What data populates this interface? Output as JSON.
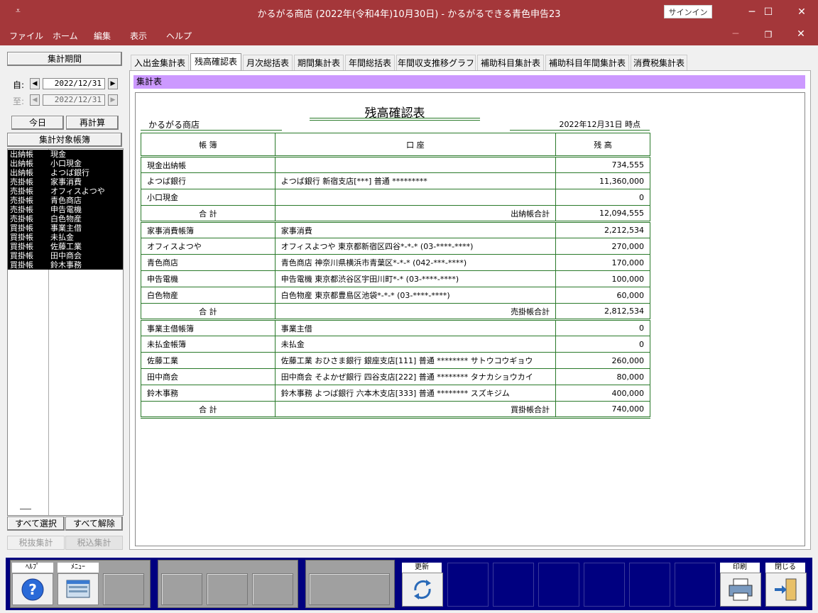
{
  "window": {
    "title": "かるがる商店 (2022年(令和4年)10月30日) - かるがるできる青色申告23",
    "signin": "サインイン",
    "minimize": "─",
    "maximize": "☐",
    "close": "✕"
  },
  "menu": {
    "items": [
      "ファイル",
      "ホーム",
      "編集",
      "表示",
      "ヘルプ"
    ]
  },
  "left": {
    "period_btn": "集計期間",
    "from_label": "自:",
    "to_label": "至:",
    "from_date": "2022/12/31",
    "to_date": "2022/12/31",
    "today_btn": "今日",
    "recalc_btn": "再計算",
    "target_btn": "集計対象帳簿",
    "ledgers": [
      {
        "type": "出納帳",
        "name": "現金"
      },
      {
        "type": "出納帳",
        "name": "小口現金"
      },
      {
        "type": "出納帳",
        "name": "よつば銀行"
      },
      {
        "type": "売掛帳",
        "name": "家事消費"
      },
      {
        "type": "売掛帳",
        "name": "オフィスよつや"
      },
      {
        "type": "売掛帳",
        "name": "青色商店"
      },
      {
        "type": "売掛帳",
        "name": "申告電機"
      },
      {
        "type": "売掛帳",
        "name": "白色物産"
      },
      {
        "type": "買掛帳",
        "name": "事業主借"
      },
      {
        "type": "買掛帳",
        "name": "未払金"
      },
      {
        "type": "買掛帳",
        "name": "佐藤工業"
      },
      {
        "type": "買掛帳",
        "name": "田中商会"
      },
      {
        "type": "買掛帳",
        "name": "鈴木事務"
      }
    ],
    "select_all": "すべて選択",
    "deselect_all": "すべて解除",
    "tax_excl": "税抜集計",
    "tax_incl": "税込集計"
  },
  "tabs": [
    "入出金集計表",
    "残高確認表",
    "月次総括表",
    "期間集計表",
    "年間総括表",
    "年間収支推移グラフ",
    "補助科目集計表",
    "補助科目年間集計表",
    "消費税集計表"
  ],
  "section_header": "集計表",
  "report": {
    "title": "残高確認表",
    "shop": "かるがる商店",
    "asof": "2022年12月31日 時点",
    "headers": [
      "帳 簿",
      "口 座",
      "残 高"
    ],
    "rows": [
      {
        "book": "現金出納帳",
        "account": "",
        "balance": "734,555"
      },
      {
        "book": "よつば銀行",
        "account": "よつば銀行 新宿支店[***] 普通 *********",
        "balance": "11,360,000"
      },
      {
        "book": "小口現金",
        "account": "",
        "balance": "0"
      },
      {
        "book": "合 計",
        "account": "出納帳合計",
        "balance": "12,094,555",
        "total": true
      },
      {
        "book": "家事消費帳簿",
        "account": "家事消費",
        "balance": "2,212,534"
      },
      {
        "book": "オフィスよつや",
        "account": "オフィスよつや  東京都新宿区四谷*-*-* (03-****-****)",
        "balance": "270,000"
      },
      {
        "book": "青色商店",
        "account": "青色商店  神奈川県横浜市青葉区*-*-* (042-***-****)",
        "balance": "170,000"
      },
      {
        "book": "申告電機",
        "account": "申告電機  東京都渋谷区宇田川町*-* (03-****-****)",
        "balance": "100,000"
      },
      {
        "book": "白色物産",
        "account": "白色物産  東京都豊島区池袋*-*-* (03-****-****)",
        "balance": "60,000"
      },
      {
        "book": "合 計",
        "account": "売掛帳合計",
        "balance": "2,812,534",
        "total": true
      },
      {
        "book": "事業主借帳簿",
        "account": "事業主借",
        "balance": "0"
      },
      {
        "book": "未払金帳簿",
        "account": "未払金",
        "balance": "0"
      },
      {
        "book": "佐藤工業",
        "account": "佐藤工業  おひさま銀行 銀座支店[111] 普通 ******** サトウコウギョウ",
        "balance": "260,000"
      },
      {
        "book": "田中商会",
        "account": "田中商会  そよかぜ銀行 四谷支店[222] 普通 ******** タナカショウカイ",
        "balance": "80,000"
      },
      {
        "book": "鈴木事務",
        "account": "鈴木事務  よつば銀行 六本木支店[333] 普通 ******** スズキジム",
        "balance": "400,000"
      },
      {
        "book": "合 計",
        "account": "買掛帳合計",
        "balance": "740,000",
        "total": true
      }
    ]
  },
  "toolbar": {
    "help": "ﾍﾙﾌﾟ",
    "menu": "ﾒﾆｭｰ",
    "refresh": "更新",
    "print": "印刷",
    "close": "閉じる"
  }
}
